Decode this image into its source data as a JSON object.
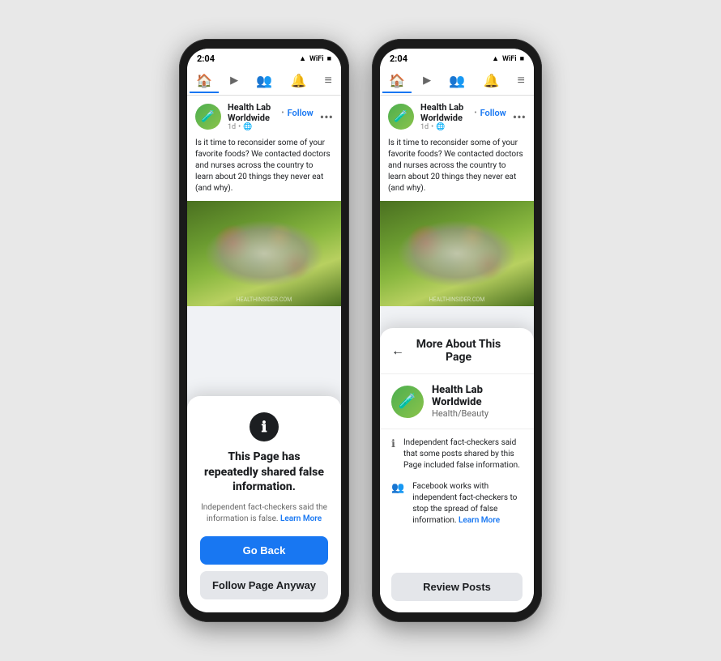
{
  "app": {
    "bg_color": "#e8e8e8"
  },
  "phone1": {
    "status": {
      "time": "2:04",
      "signal": "▲◀",
      "wifi": "WiFi",
      "battery": "▓"
    },
    "navbar": {
      "items": [
        {
          "icon": "🏠",
          "label": "Home",
          "active": true
        },
        {
          "icon": "▶",
          "label": "Watch",
          "active": false
        },
        {
          "icon": "👥",
          "label": "People",
          "active": false
        },
        {
          "icon": "🔔",
          "label": "Notifications",
          "active": false
        },
        {
          "icon": "≡",
          "label": "Menu",
          "active": false
        }
      ]
    },
    "post": {
      "page_name": "Health Lab Worldwide",
      "follow_label": "Follow",
      "time": "1d",
      "privacy": "🌐",
      "text": "Is it time to reconsider some of your favorite foods? We contacted doctors and nurses across the country to learn about 20 things they never eat (and why).",
      "more_btn": "•••"
    },
    "warning_sheet": {
      "info_symbol": "ℹ",
      "title": "This Page has repeatedly shared\nfalse information.",
      "subtitle_pre": "Independent fact-checkers said the information is false.",
      "learn_more_label": "Learn More",
      "go_back_label": "Go Back",
      "follow_anyway_label": "Follow Page Anyway"
    }
  },
  "phone2": {
    "status": {
      "time": "2:04"
    },
    "navbar": {
      "items": [
        {
          "icon": "🏠",
          "label": "Home",
          "active": true
        },
        {
          "icon": "▶",
          "label": "Watch",
          "active": false
        },
        {
          "icon": "👥",
          "label": "People",
          "active": false
        },
        {
          "icon": "🔔",
          "label": "Notifications",
          "active": false
        },
        {
          "icon": "≡",
          "label": "Menu",
          "active": false
        }
      ]
    },
    "post": {
      "page_name": "Health Lab Worldwide",
      "follow_label": "Follow",
      "time": "1d",
      "text": "Is it time to reconsider some of your favorite foods? We contacted doctors and nurses across the country to learn about 20 things they never eat (and why).",
      "more_btn": "•••"
    },
    "more_about_panel": {
      "back_arrow": "←",
      "title": "More About This Page",
      "page_name": "Health Lab Worldwide",
      "page_category": "Health/Beauty",
      "fact_items": [
        {
          "icon": "ℹ",
          "text": "Independent fact-checkers said that some posts shared by this Page included false information."
        },
        {
          "icon": "👥",
          "text": "Facebook works with independent fact-checkers to stop the spread of false information."
        }
      ],
      "learn_more_label": "Learn More",
      "review_posts_label": "Review Posts"
    }
  }
}
